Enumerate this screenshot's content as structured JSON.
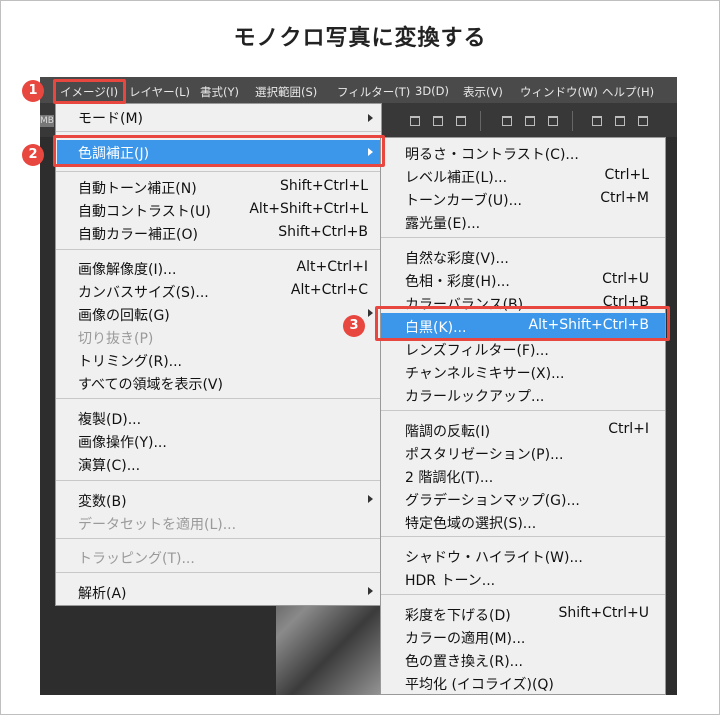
{
  "title": "モノクロ写真に変換する",
  "menubar": {
    "partial_left": ")",
    "items": [
      "イメージ(I)",
      "レイヤー(L)",
      "書式(Y)",
      "選択範囲(S)",
      "フィルター(T)",
      "3D(D)",
      "表示(V)",
      "ウィンドウ(W)",
      "ヘルプ(H)"
    ]
  },
  "toolbar": {
    "mb_label": "MB"
  },
  "badges": [
    "1",
    "2",
    "3"
  ],
  "image_menu": {
    "mode": "モード(M)",
    "adjust": "色調補正(J)",
    "auto_tone": {
      "label": "自動トーン補正(N)",
      "shortcut": "Shift+Ctrl+L"
    },
    "auto_contrast": {
      "label": "自動コントラスト(U)",
      "shortcut": "Alt+Shift+Ctrl+L"
    },
    "auto_color": {
      "label": "自動カラー補正(O)",
      "shortcut": "Shift+Ctrl+B"
    },
    "image_size": {
      "label": "画像解像度(I)...",
      "shortcut": "Alt+Ctrl+I"
    },
    "canvas_size": {
      "label": "カンバスサイズ(S)...",
      "shortcut": "Alt+Ctrl+C"
    },
    "rotation": "画像の回転(G)",
    "crop": "切り抜き(P)",
    "trim": "トリミング(R)...",
    "reveal_all": "すべての領域を表示(V)",
    "duplicate": "複製(D)...",
    "apply_image": "画像操作(Y)...",
    "calculations": "演算(C)...",
    "variables": "変数(B)",
    "apply_dataset": "データセットを適用(L)...",
    "trap": "トラッピング(T)...",
    "analysis": "解析(A)"
  },
  "adjust_menu": {
    "brightness": "明るさ・コントラスト(C)...",
    "levels": {
      "label": "レベル補正(L)...",
      "shortcut": "Ctrl+L"
    },
    "curves": {
      "label": "トーンカーブ(U)...",
      "shortcut": "Ctrl+M"
    },
    "exposure": "露光量(E)...",
    "vibrance": "自然な彩度(V)...",
    "hue_sat": {
      "label": "色相・彩度(H)...",
      "shortcut": "Ctrl+U"
    },
    "color_balance": {
      "label": "カラーバランス(B)...",
      "shortcut": "Ctrl+B"
    },
    "bw": {
      "label": "白黒(K)...",
      "shortcut": "Alt+Shift+Ctrl+B"
    },
    "photo_filter": "レンズフィルター(F)...",
    "channel_mixer": "チャンネルミキサー(X)...",
    "color_lookup": "カラールックアップ...",
    "invert": {
      "label": "階調の反転(I)",
      "shortcut": "Ctrl+I"
    },
    "posterize": "ポスタリゼーション(P)...",
    "threshold": "2 階調化(T)...",
    "gradient_map": "グラデーションマップ(G)...",
    "selective_color": "特定色域の選択(S)...",
    "shadows_highlights": "シャドウ・ハイライト(W)...",
    "hdr_toning": "HDR トーン...",
    "desaturate": {
      "label": "彩度を下げる(D)",
      "shortcut": "Shift+Ctrl+U"
    },
    "match_color": "カラーの適用(M)...",
    "replace_color": "色の置き換え(R)...",
    "equalize": "平均化 (イコライズ)(Q)"
  },
  "colors": {
    "highlight": "#3c97ea",
    "annotation": "#e8473f"
  }
}
